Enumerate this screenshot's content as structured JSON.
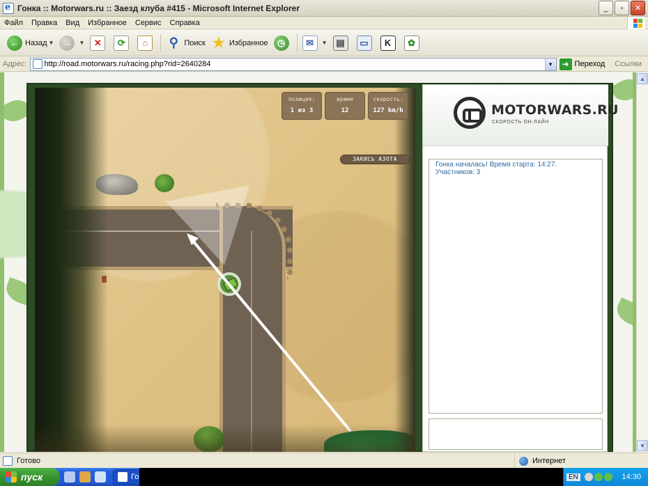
{
  "window": {
    "title": "Гонка :: Motorwars.ru :: Заезд клуба #415 - Microsoft Internet Explorer",
    "minimize": "_",
    "maximize": "▫",
    "close": "✕"
  },
  "menu": [
    "Файл",
    "Правка",
    "Вид",
    "Избранное",
    "Сервис",
    "Справка"
  ],
  "toolbar": {
    "back_label": "Назад",
    "search_label": "Поиск",
    "favorites_label": "Избранное"
  },
  "address": {
    "label": "Адрес:",
    "url": "http://road.motorwars.ru/racing.php?rid=2640284",
    "go_label": "Переход",
    "links_label": "Ссылки"
  },
  "game": {
    "hud": [
      {
        "label": "позиция:",
        "value": "1 из 3"
      },
      {
        "label": "время",
        "value": "12"
      },
      {
        "label": "скорость:",
        "value": "127 km/h"
      }
    ],
    "nitro_label": "ЗАКИСЬ АЗОТА"
  },
  "panel": {
    "logo_text": "MOTORWARS.RU",
    "logo_tagline": "СКОРОСТЬ ОН-ЛАЙН",
    "chat_message": "Гонка началась! Время старта: 14:27. Участников: 3"
  },
  "status": {
    "text": "Готово",
    "zone": "Интернет"
  },
  "taskbar": {
    "start_label": "пуск",
    "task_label": "Го",
    "lang": "EN",
    "clock": "14:30"
  }
}
